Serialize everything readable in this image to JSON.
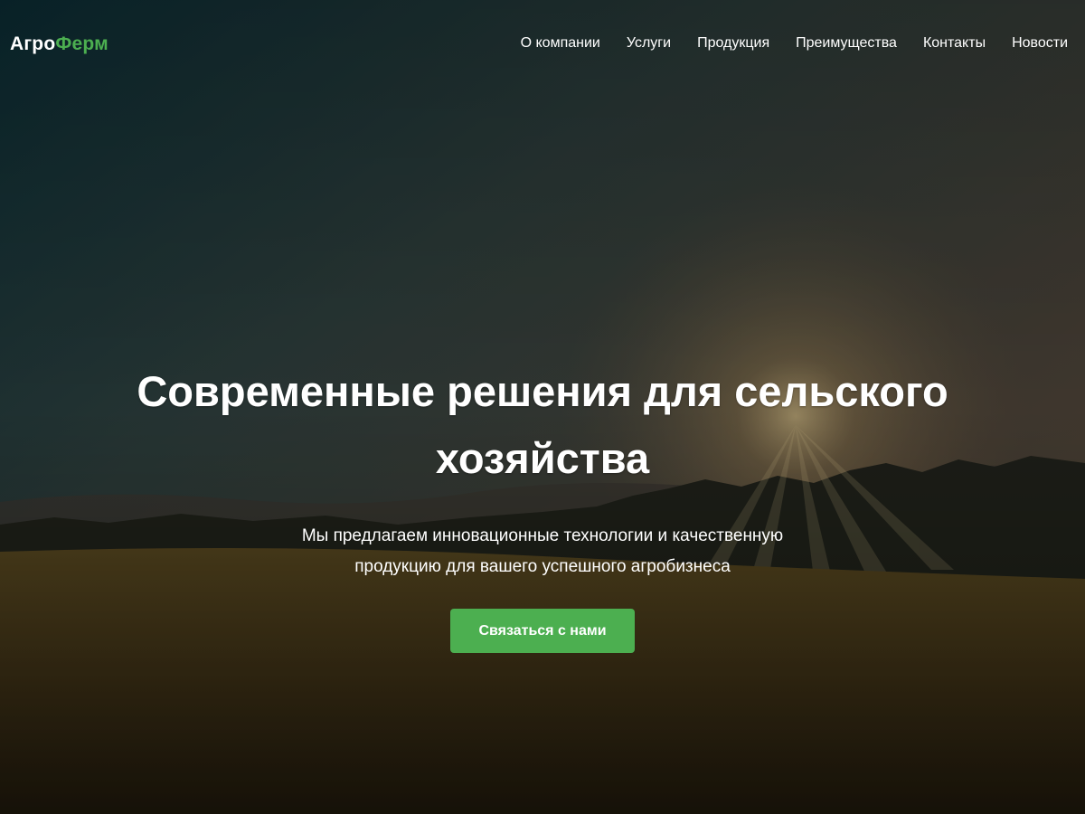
{
  "brand": {
    "logo_part1": "Агро",
    "logo_part2": "Ферм",
    "accent_color": "#4CAF50"
  },
  "nav": {
    "items": [
      {
        "label": "О компании"
      },
      {
        "label": "Услуги"
      },
      {
        "label": "Продукция"
      },
      {
        "label": "Преимущества"
      },
      {
        "label": "Контакты"
      },
      {
        "label": "Новости"
      }
    ]
  },
  "hero": {
    "title": "Современные решения для сельского хозяйства",
    "subtitle": "Мы предлагаем инновационные технологии и качественную продукцию для вашего успешного агробизнеса",
    "cta_label": "Связаться с нами",
    "background_image": "sunset-wheat-field"
  }
}
